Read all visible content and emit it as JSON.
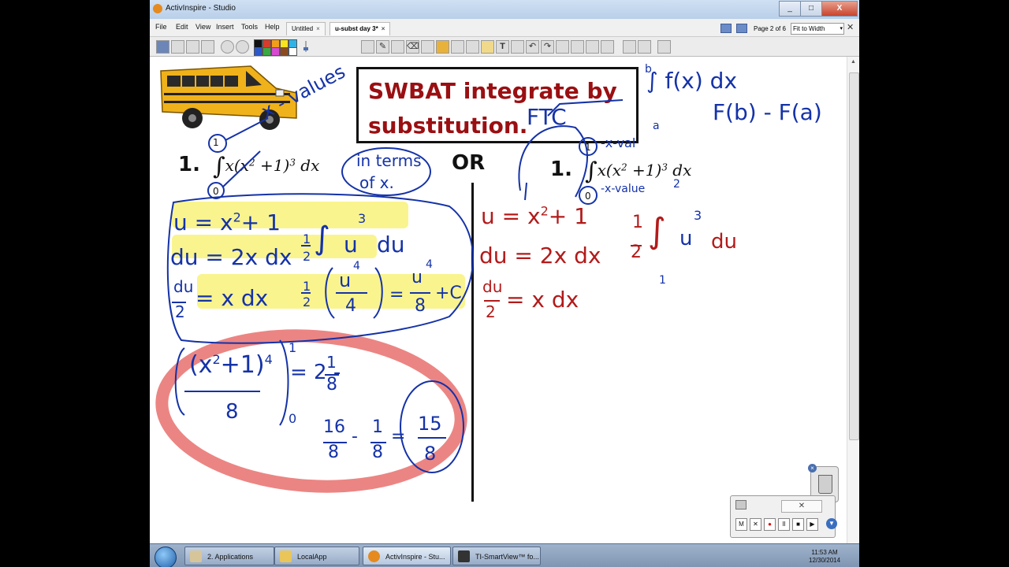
{
  "window": {
    "title": "ActivInspire - Studio",
    "controls": [
      "_",
      "□",
      "X"
    ]
  },
  "menubar": {
    "items": [
      "File",
      "Edit",
      "View",
      "Insert",
      "Tools",
      "Help"
    ],
    "tabs": [
      {
        "label": "Untitled",
        "close": "×"
      },
      {
        "label": "u-subst day 3*",
        "close": "×"
      }
    ],
    "page_info": "Page 2 of 6",
    "zoom": "Fit to Width",
    "zoom_arrow": "▾",
    "close": "✕"
  },
  "toolbar": {
    "palette": [
      "#111111",
      "#d83a2b",
      "#f29d1c",
      "#f7e31e",
      "#2fb3e6",
      "#2c59c9",
      "#3aa843",
      "#d64ad0",
      "#8a4b21",
      "#ffffff"
    ],
    "glyphs": [
      "🖐",
      "✎",
      "⌫",
      "⟲",
      "T",
      "↶",
      "↷"
    ]
  },
  "lesson": {
    "objective": "SWBAT integrate by substitution.",
    "left": {
      "number": "1.",
      "integral_sign": "∫",
      "integrand_a": "x(x",
      "exp2": "2",
      "integrand_b": " +1)",
      "exp3": "3",
      "integrand_c": " dx",
      "lower": "0",
      "upper": "1"
    },
    "or": "OR",
    "right": {
      "number": "1.",
      "integral_sign": "∫",
      "integrand_a": "x(x",
      "exp2": "2",
      "integrand_b": " +1)",
      "exp3": "3",
      "integrand_c": " dx",
      "lower": "0",
      "upper": "1"
    }
  },
  "annotations": {
    "x_values": "x - values",
    "in_terms": "in terms",
    "of_x": "of x.",
    "ftc": "FTC",
    "b": "b",
    "a": "a",
    "fx_int": "∫ f(x) dx",
    "fb_fa": "F(b) - F(a)",
    "right_upper": "-x-val",
    "right_lower": "-x-value",
    "right_two": "2",
    "right_one_over_two": "1",
    "right_two_den": "2",
    "right_int": "∫",
    "right_u": "u",
    "right_3": "3",
    "right_du": "du",
    "right_low": "1",
    "red1": "u = x",
    "red1_exp": "2",
    "red1_end": "+ 1",
    "red2": "du = 2x dx",
    "red3_num": "du",
    "red3_den": "2",
    "red3_rhs": "= x dx",
    "blue1": "u = x",
    "blue1_exp": "2",
    "blue1_end": "+ 1",
    "blue2": "du = 2x dx",
    "blue_half1": "1",
    "blue_half1_den": "2",
    "blue_int": "∫",
    "blue_u3": "u",
    "blue_3": "3",
    "blue_du": "du",
    "blue3_num": "du",
    "blue3_den": "2",
    "blue3_rhs": "= x dx",
    "blue_half2": "1",
    "blue_half2_den": "2",
    "blue_u4": "u",
    "blue_4": "4",
    "blue_4den": "4",
    "blue_eq": "=",
    "blue_u4b": "u",
    "blue_4b": "4",
    "blue_8": "8",
    "blue_c": "+C",
    "eval_top": "(x",
    "eval_exp2": "2",
    "eval_mid": "+1)",
    "eval_exp4": "4",
    "eval_den": "8",
    "eval_upper": "1",
    "eval_lower": "0",
    "eval_eq": "= 2 -",
    "eval_frac_n": "1",
    "eval_frac_d": "8",
    "step_16": "16",
    "step_8a": "8",
    "step_minus": "-",
    "step_1": "1",
    "step_8b": "8",
    "step_eq": "=",
    "answer_n": "15",
    "answer_d": "8"
  },
  "recorder": {
    "close": "✕",
    "buttons": [
      "M",
      "✕",
      "●",
      "II",
      "■",
      "▶"
    ]
  },
  "trash": {
    "close": "×"
  },
  "expand": "▼",
  "taskbar": {
    "items": [
      {
        "label": "2. Applications"
      },
      {
        "label": "LocalApp"
      },
      {
        "label": "ActivInspire - Stu..."
      },
      {
        "label": "TI-SmartView™ fo..."
      }
    ],
    "time": "11:53 AM",
    "date": "12/30/2014"
  }
}
